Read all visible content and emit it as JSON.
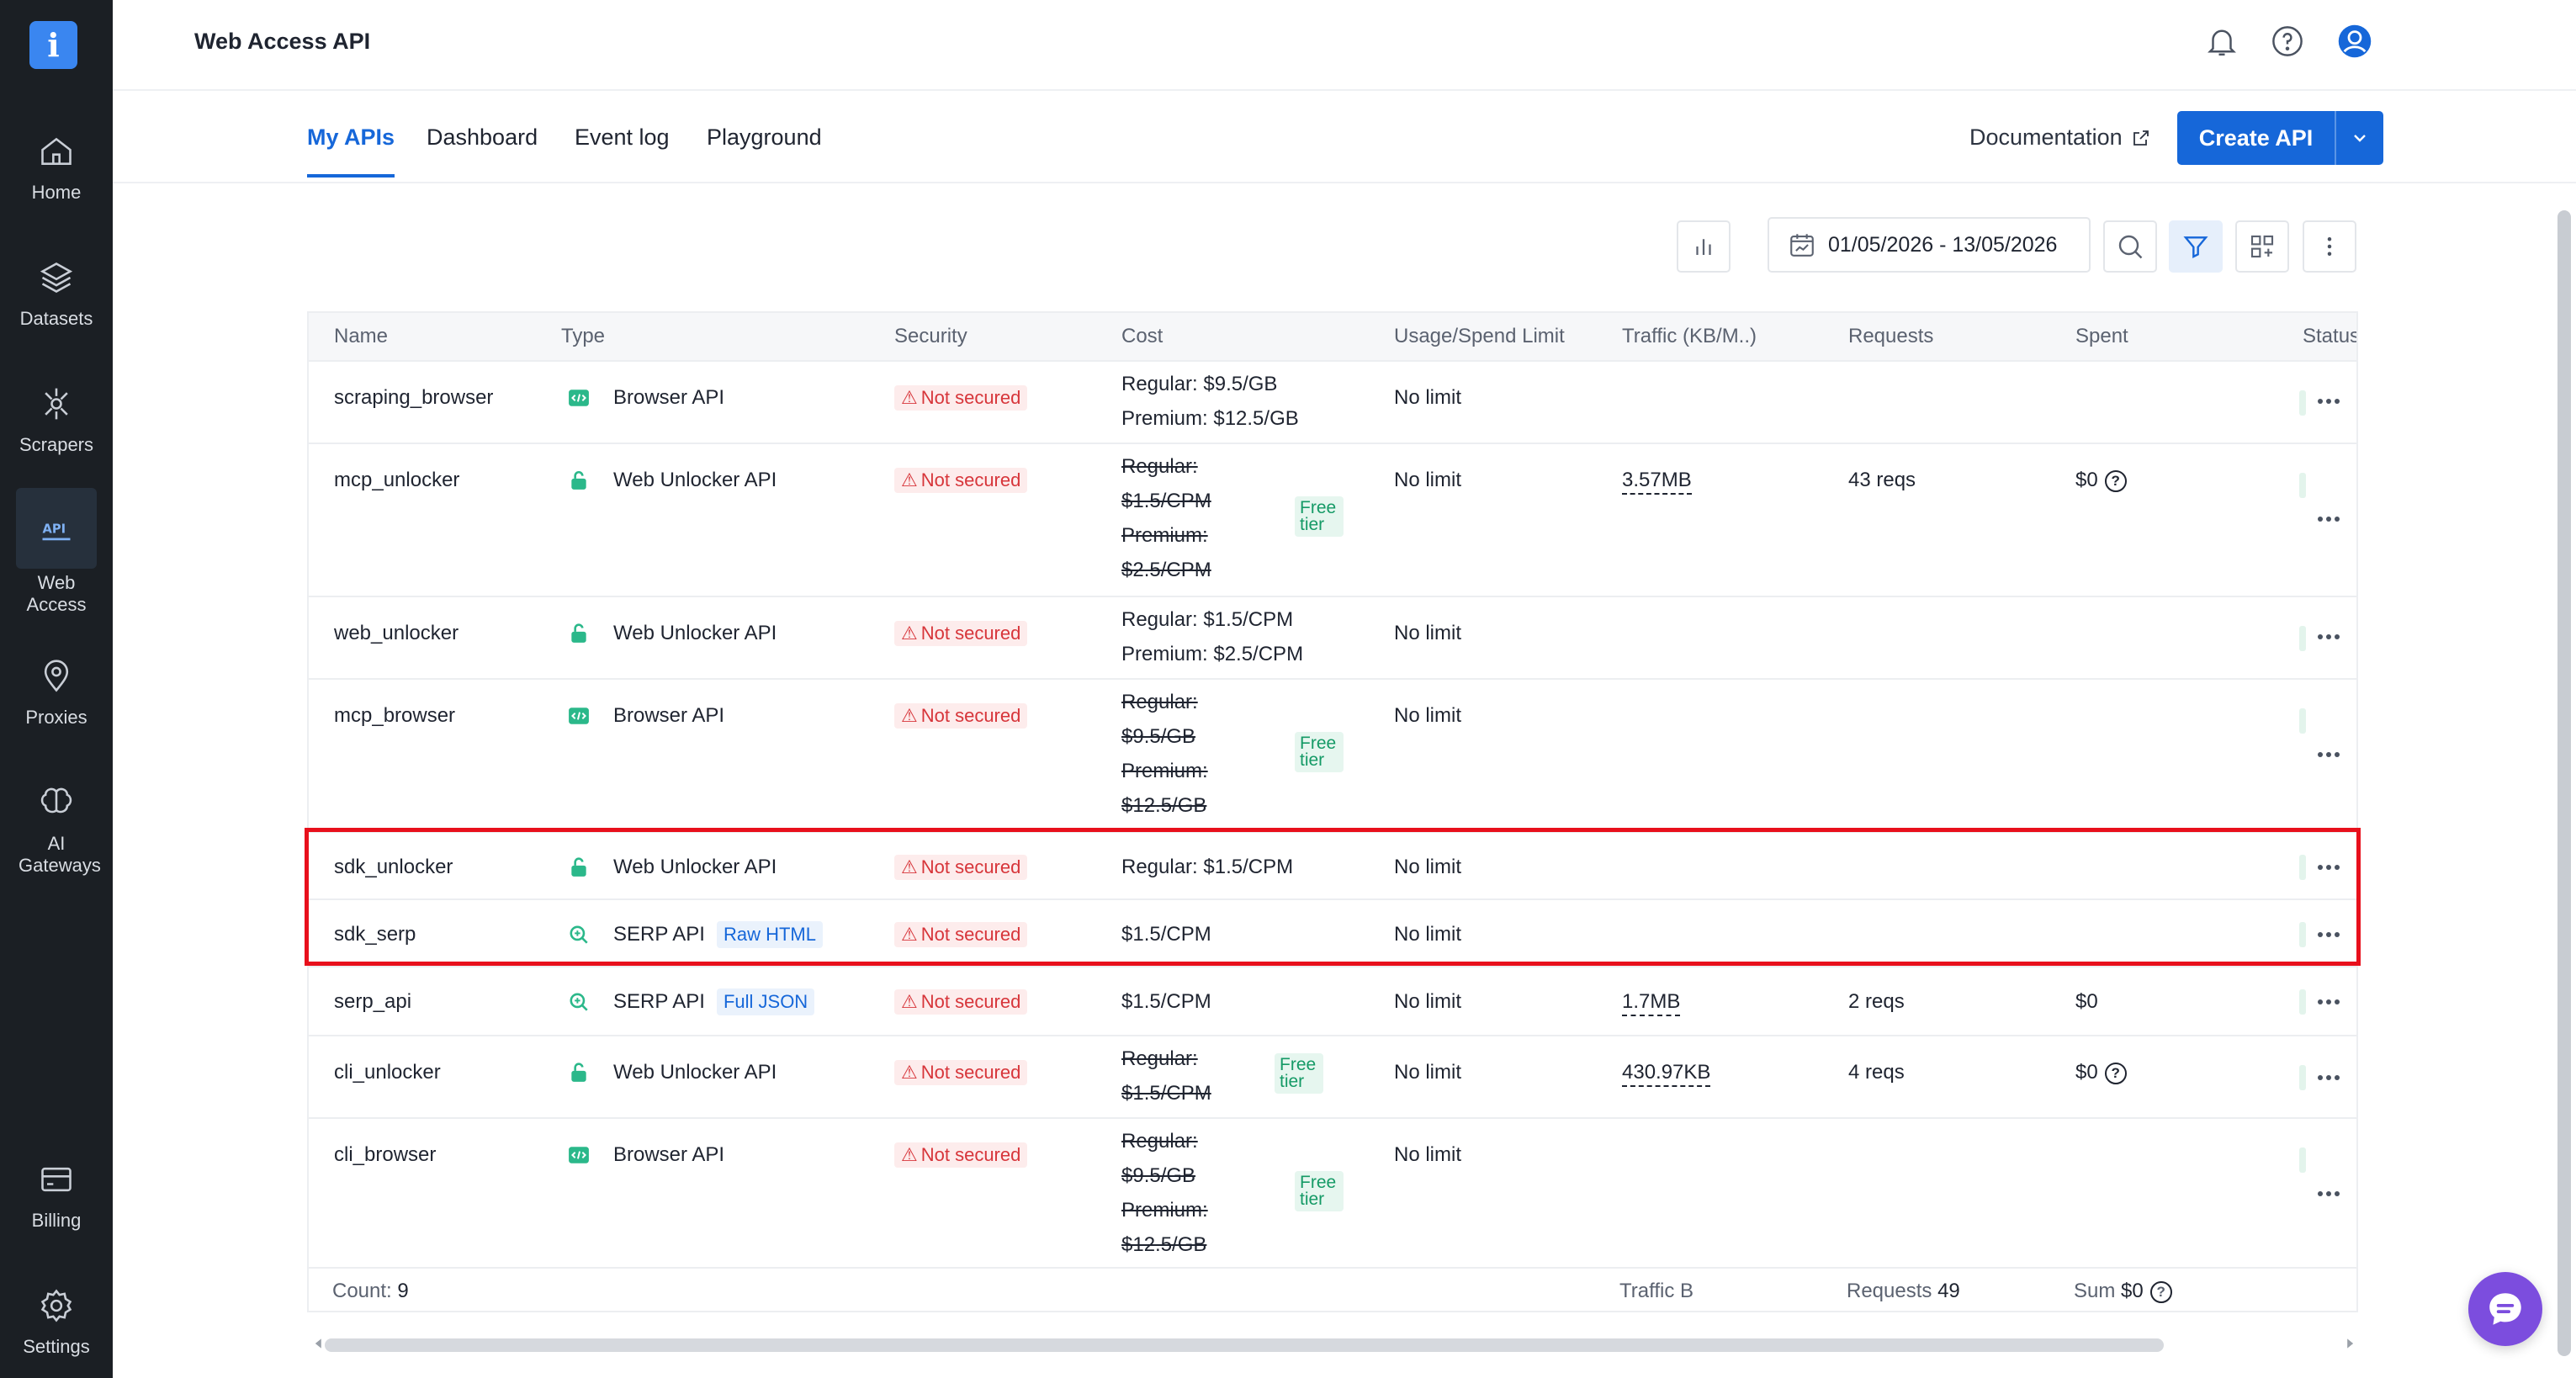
{
  "nav": {
    "logo": "i",
    "items": [
      {
        "label": "Home",
        "icon": "home-icon"
      },
      {
        "label": "Datasets",
        "icon": "database-icon"
      },
      {
        "label": "Scrapers",
        "icon": "scrapers-icon"
      },
      {
        "label": "Web Access",
        "icon": "api-icon"
      },
      {
        "label": "Proxies",
        "icon": "location-pin-icon"
      },
      {
        "label": "AI Gateways",
        "icon": "brain-icon"
      },
      {
        "label": "Billing",
        "icon": "billing-icon"
      },
      {
        "label": "Settings",
        "icon": "gear-icon"
      }
    ]
  },
  "header": {
    "title": "Web Access API"
  },
  "tabs": [
    "My APIs",
    "Dashboard",
    "Event log",
    "Playground"
  ],
  "actions": {
    "documentation": "Documentation",
    "create_api": "Create API"
  },
  "toolbar": {
    "date_range": "01/05/2026 - 13/05/2026"
  },
  "columns": [
    "Name",
    "Type",
    "Security",
    "Cost",
    "Usage/Spend Limit",
    "Traffic (KB/M..)",
    "Requests",
    "Spent",
    "Status"
  ],
  "rows": [
    {
      "name": "scraping_browser",
      "type": "Browser API",
      "security": "Not secured",
      "cost": [
        "Regular: $9.5/GB",
        "Premium: $12.5/GB"
      ],
      "limit": "No limit"
    },
    {
      "name": "mcp_unlocker",
      "type": "Web Unlocker API",
      "security": "Not secured",
      "cost": [
        "Regular:",
        "$1.5/CPM",
        "Premium:",
        "$2.5/CPM"
      ],
      "free": "Free tier",
      "limit": "No limit",
      "traffic": "3.57MB",
      "requests": "43 reqs",
      "spent": "$0"
    },
    {
      "name": "web_unlocker",
      "type": "Web Unlocker API",
      "security": "Not secured",
      "cost": [
        "Regular: $1.5/CPM",
        "Premium: $2.5/CPM"
      ],
      "limit": "No limit"
    },
    {
      "name": "mcp_browser",
      "type": "Browser API",
      "security": "Not secured",
      "cost": [
        "Regular:",
        "$9.5/GB",
        "Premium:",
        "$12.5/GB"
      ],
      "free": "Free tier",
      "limit": "No limit"
    },
    {
      "name": "sdk_unlocker",
      "type": "Web Unlocker API",
      "security": "Not secured",
      "cost": [
        "Regular: $1.5/CPM"
      ],
      "limit": "No limit"
    },
    {
      "name": "sdk_serp",
      "type": "SERP API",
      "type_badge": "Raw HTML",
      "security": "Not secured",
      "cost": [
        "$1.5/CPM"
      ],
      "limit": "No limit"
    },
    {
      "name": "serp_api",
      "type": "SERP API",
      "type_badge": "Full JSON",
      "security": "Not secured",
      "cost": [
        "$1.5/CPM"
      ],
      "limit": "No limit",
      "traffic": "1.7MB",
      "requests": "2 reqs",
      "spent": "$0"
    },
    {
      "name": "cli_unlocker",
      "type": "Web Unlocker API",
      "security": "Not secured",
      "cost": [
        "Regular:",
        "$1.5/CPM"
      ],
      "free": "Free tier",
      "limit": "No limit",
      "traffic": "430.97KB",
      "requests": "4 reqs",
      "spent": "$0"
    },
    {
      "name": "cli_browser",
      "type": "Browser API",
      "security": "Not secured",
      "cost": [
        "Regular:",
        "$9.5/GB",
        "Premium:",
        "$12.5/GB"
      ],
      "free": "Free tier",
      "limit": "No limit"
    }
  ],
  "footer": {
    "count_label": "Count:",
    "count_value": "9",
    "traffic_label": "Traffic B",
    "requests_label": "Requests",
    "requests_value": "49",
    "sum_label": "Sum",
    "sum_value": "$0"
  },
  "colors": {
    "accent": "#1667d9",
    "sidebar": "#1b1f24",
    "danger": "#d7353a",
    "free_tier": "#159a66",
    "highlight": "#e8101c"
  }
}
